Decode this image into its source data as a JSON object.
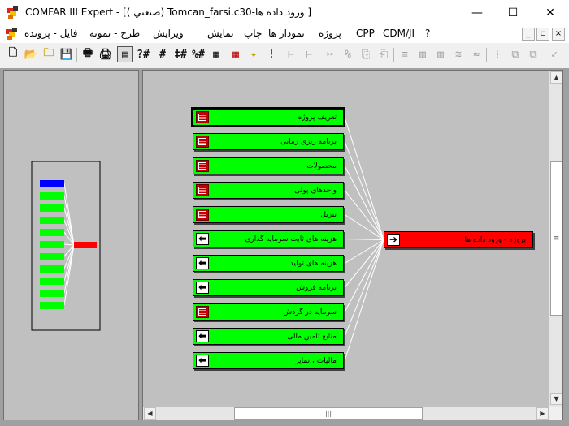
{
  "window": {
    "title": "COMFAR III Expert - [( صنعتي) Tomcan_farsi.c30-ورود داده ها ]",
    "minimize_glyph": "—",
    "maximize_glyph": "☐",
    "close_glyph": "✕"
  },
  "menu": {
    "items": [
      "فایل - پرونده",
      "طرح - نمونه",
      "ویرایش",
      "نمایش",
      "چاپ",
      "نمودار ها",
      "پروژه",
      "CPP",
      "CDM/JI",
      "?"
    ],
    "mdi_minimize": "_",
    "mdi_restore": "▫",
    "mdi_close": "×"
  },
  "toolbar": {
    "new_glyph": "🗋",
    "open_glyph": "📂",
    "folder_glyph": "🗀",
    "save_glyph": "💾",
    "print_glyph": "🖶",
    "print_setup_glyph": "🖨",
    "list_view_glyph": "▤",
    "help_query_glyph": "?#",
    "grid_hash_glyph": "#",
    "hash_sub_glyph": "‡#",
    "percent_hash_glyph": "%#",
    "table_glyph": "▦",
    "calc_glyph": "▦",
    "wizard_glyph": "✦",
    "alert_glyph": "!",
    "tree_glyph": "⊢",
    "cut_glyph": "✂",
    "percent_glyph": "%",
    "copy_glyph": "⎘",
    "paste_glyph": "⎗",
    "col_glyph": "≡",
    "bars_glyph": "▥",
    "bars2_glyph": "▥",
    "chart_glyph": "≋",
    "wave_glyph": "≈",
    "grid_glyph": "⁞",
    "layout_glyph": "⧉",
    "layout2_glyph": "⧉",
    "check_glyph": "✓"
  },
  "overview": {
    "accent_blue": "#0000ff",
    "accent_green": "#00ff00",
    "accent_red": "#ff0000"
  },
  "diagram": {
    "target": {
      "label": "پروژه - ورود داده ها",
      "icon": "arrow-right",
      "color": "#ff0000"
    },
    "nodes": [
      {
        "label": "تعریف پروژه",
        "icon": "calendar",
        "selected": true
      },
      {
        "label": "برنامه ریزی زمانی",
        "icon": "calendar"
      },
      {
        "label": "محصولات",
        "icon": "calendar"
      },
      {
        "label": "واحدهای پولی",
        "icon": "calendar"
      },
      {
        "label": "تنزیل",
        "icon": "calendar"
      },
      {
        "label": "هزینه های ثابت سرمایه گذاری",
        "icon": "arrow-left"
      },
      {
        "label": "هزینه های تولید",
        "icon": "arrow-left"
      },
      {
        "label": "برنامه فروش",
        "icon": "arrow-left"
      },
      {
        "label": "سرمایه در گردش",
        "icon": "calendar"
      },
      {
        "label": "منابع تامین مالی",
        "icon": "arrow-left"
      },
      {
        "label": "مالیات ، تمایز",
        "icon": "arrow-left"
      }
    ]
  },
  "scrollbar": {
    "up_glyph": "▲",
    "down_glyph": "▼",
    "left_glyph": "◀",
    "right_glyph": "▶",
    "grip_glyph": "≡",
    "hgrip_glyph": "|||"
  }
}
